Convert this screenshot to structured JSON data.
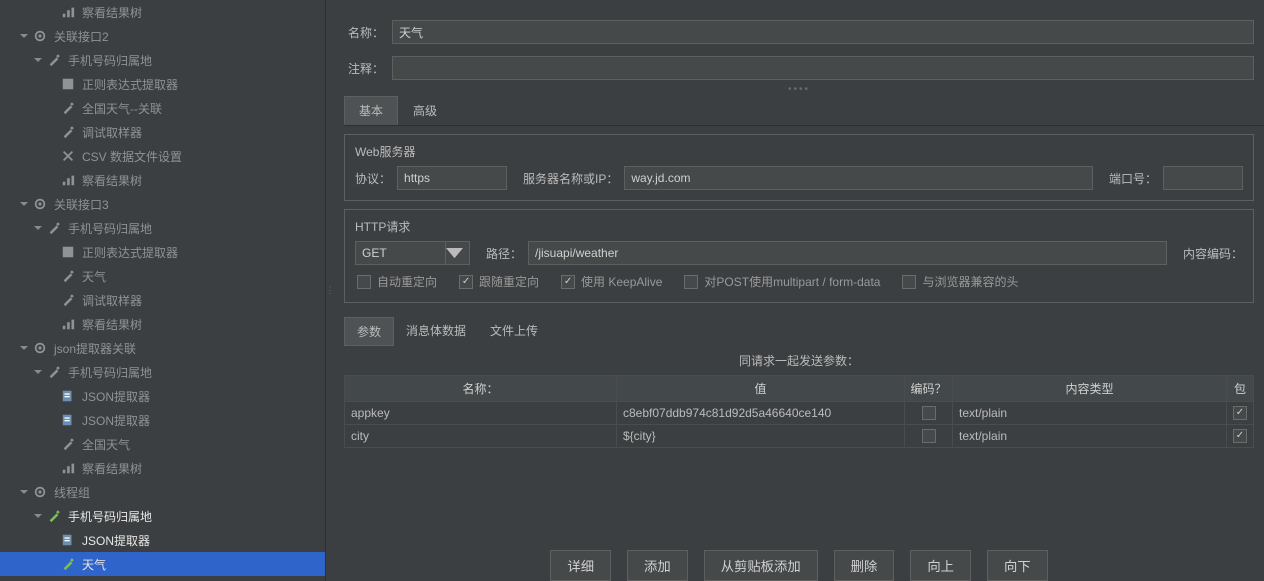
{
  "tree": {
    "items": [
      {
        "indent": 3,
        "toggle": "",
        "icon": "results",
        "label": "察看结果树"
      },
      {
        "indent": 1,
        "toggle": "down",
        "icon": "gear",
        "label": "关联接口2"
      },
      {
        "indent": 2,
        "toggle": "down",
        "icon": "sampler",
        "label": "手机号码归属地"
      },
      {
        "indent": 3,
        "toggle": "",
        "icon": "extractor",
        "label": "正则表达式提取器"
      },
      {
        "indent": 3,
        "toggle": "",
        "icon": "sampler",
        "label": "全国天气--关联"
      },
      {
        "indent": 3,
        "toggle": "",
        "icon": "sampler",
        "label": "调试取样器"
      },
      {
        "indent": 3,
        "toggle": "",
        "icon": "csv",
        "label": "CSV 数据文件设置"
      },
      {
        "indent": 3,
        "toggle": "",
        "icon": "results",
        "label": "察看结果树"
      },
      {
        "indent": 1,
        "toggle": "down",
        "icon": "gear",
        "label": "关联接口3"
      },
      {
        "indent": 2,
        "toggle": "down",
        "icon": "sampler",
        "label": "手机号码归属地"
      },
      {
        "indent": 3,
        "toggle": "",
        "icon": "extractor",
        "label": "正则表达式提取器"
      },
      {
        "indent": 3,
        "toggle": "",
        "icon": "sampler",
        "label": "天气"
      },
      {
        "indent": 3,
        "toggle": "",
        "icon": "sampler",
        "label": "调试取样器"
      },
      {
        "indent": 3,
        "toggle": "",
        "icon": "results",
        "label": "察看结果树"
      },
      {
        "indent": 1,
        "toggle": "down",
        "icon": "gear",
        "label": "json提取器关联"
      },
      {
        "indent": 2,
        "toggle": "down",
        "icon": "sampler",
        "label": "手机号码归属地"
      },
      {
        "indent": 3,
        "toggle": "",
        "icon": "json",
        "label": "JSON提取器"
      },
      {
        "indent": 3,
        "toggle": "",
        "icon": "json",
        "label": "JSON提取器"
      },
      {
        "indent": 3,
        "toggle": "",
        "icon": "sampler",
        "label": "全国天气"
      },
      {
        "indent": 3,
        "toggle": "",
        "icon": "results",
        "label": "察看结果树"
      },
      {
        "indent": 1,
        "toggle": "down",
        "icon": "gear",
        "label": "线程组"
      },
      {
        "indent": 2,
        "toggle": "down",
        "icon": "sampler-g",
        "label": "手机号码归属地",
        "bright": true
      },
      {
        "indent": 3,
        "toggle": "",
        "icon": "json",
        "label": "JSON提取器",
        "bright": true
      },
      {
        "indent": 3,
        "toggle": "",
        "icon": "sampler-g",
        "label": "天气",
        "selected": true
      }
    ]
  },
  "form": {
    "name_label": "名称：",
    "name_value": "天气",
    "comment_label": "注释：",
    "comment_value": ""
  },
  "tabs": {
    "basic": "基本",
    "advanced": "高级"
  },
  "web": {
    "section": "Web服务器",
    "protocol_label": "协议：",
    "protocol_value": "https",
    "server_label": "服务器名称或IP：",
    "server_value": "way.jd.com",
    "port_label": "端口号："
  },
  "http": {
    "section": "HTTP请求",
    "method": "GET",
    "path_label": "路径：",
    "path_value": "/jisuapi/weather",
    "encoding_label": "内容编码：",
    "cb_auto": "自动重定向",
    "cb_follow": "跟随重定向",
    "cb_keepalive": "使用 KeepAlive",
    "cb_multipart": "对POST使用multipart / form-data",
    "cb_browser": "与浏览器兼容的头"
  },
  "paramTabs": {
    "params": "参数",
    "body": "消息体数据",
    "file": "文件上传"
  },
  "table": {
    "title": "同请求一起发送参数：",
    "h_name": "名称：",
    "h_value": "值",
    "h_encode": "编码？",
    "h_type": "内容类型",
    "h_last": "包",
    "rows": [
      {
        "name": "appkey",
        "value": "c8ebf07ddb974c81d92d5a46640ce140",
        "type": "text/plain"
      },
      {
        "name": "city",
        "value": "${city}",
        "type": "text/plain"
      }
    ]
  },
  "buttons": {
    "detail": "详细",
    "add": "添加",
    "clip": "从剪贴板添加",
    "delete": "删除",
    "up": "向上",
    "down": "向下"
  }
}
